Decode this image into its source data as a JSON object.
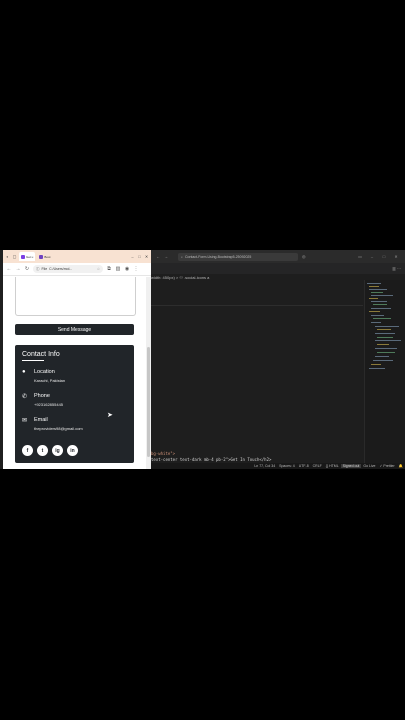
{
  "browser": {
    "tabs": [
      {
        "label": "Get u"
      },
      {
        "label": "Boot"
      }
    ],
    "window_controls": [
      "–",
      "□",
      "✕"
    ],
    "address": {
      "prefix": "File",
      "url": "C:/Users/mol..."
    },
    "send_label": "Send Message",
    "contact": {
      "title": "Contact Info",
      "items": [
        {
          "label": "Location",
          "value": "Karachi, Pakistan"
        },
        {
          "label": "Phone",
          "value": "+923162855445"
        },
        {
          "label": "Email",
          "value": "theproviders98@gmail.com"
        }
      ],
      "socials": [
        "f",
        "t",
        "ig",
        "in"
      ]
    }
  },
  "editor": {
    "search_text": "Contact-Form-Using-Bootstrap5-25092025",
    "breadcrumb": "width: 450px) > ⚇ .social-icons a",
    "code_line_1": "bg-white\">",
    "code_line_2": "text-center text-dark mb-4 pb-2\">Get In Touch</h2>",
    "status": {
      "position": "Ln 77, Col 34",
      "spaces": "Spaces: 4",
      "encoding": "UTF-8",
      "eol": "CRLF",
      "language": "{} HTML",
      "signed": "Signed out",
      "golive": "Go Live",
      "prettier": "✓ Prettier"
    }
  }
}
